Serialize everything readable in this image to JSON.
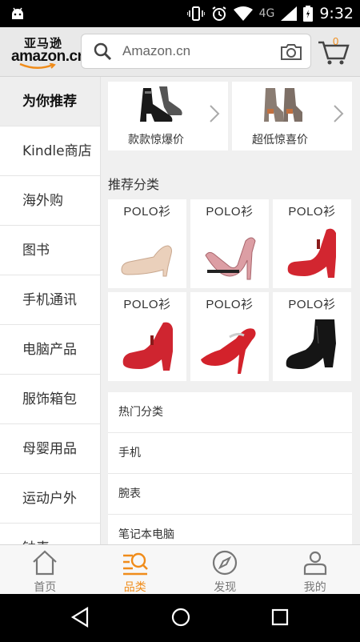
{
  "status_bar": {
    "time": "9:32",
    "network": "4G"
  },
  "header": {
    "logo_cn": "亚马逊",
    "logo_en": "amazon.cn",
    "search_placeholder": "Amazon.cn",
    "cart_count": "0"
  },
  "sidebar": {
    "items": [
      {
        "label": "为你推荐",
        "active": true
      },
      {
        "label": "Kindle商店"
      },
      {
        "label": "海外购"
      },
      {
        "label": "图书"
      },
      {
        "label": "手机通讯"
      },
      {
        "label": "电脑产品"
      },
      {
        "label": "服饰箱包"
      },
      {
        "label": "母婴用品"
      },
      {
        "label": "运动户外"
      },
      {
        "label": "钟表"
      }
    ]
  },
  "promos": [
    {
      "label": "款款惊爆价"
    },
    {
      "label": "超低惊喜价"
    }
  ],
  "recommend": {
    "title": "推荐分类",
    "tiles": [
      {
        "label": "POLO衫",
        "shoe_color": "#e9c8b0"
      },
      {
        "label": "POLO衫",
        "shoe_color": "#d99aa0"
      },
      {
        "label": "POLO衫",
        "shoe_color": "#d22630"
      },
      {
        "label": "POLO衫",
        "shoe_color": "#cf2530"
      },
      {
        "label": "POLO衫",
        "shoe_color": "#d3222b"
      },
      {
        "label": "POLO衫",
        "shoe_color": "#151515"
      }
    ]
  },
  "hot_list": {
    "items": [
      "热门分类",
      "手机",
      "腕表",
      "笔记本电脑"
    ]
  },
  "tabbar": {
    "items": [
      {
        "label": "首页"
      },
      {
        "label": "品类",
        "active": true
      },
      {
        "label": "发现"
      },
      {
        "label": "我的"
      }
    ]
  },
  "colors": {
    "accent": "#f08c1a",
    "header_bg": "#e9e9e9"
  }
}
